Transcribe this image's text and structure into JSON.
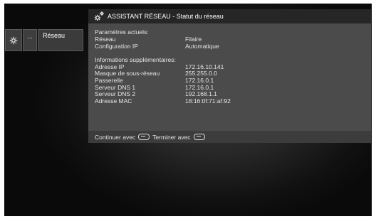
{
  "nav": {
    "settings_icon": "gear-icon",
    "more_label": "...",
    "network_label": "Réseau"
  },
  "dialog": {
    "icon": "gears-icon",
    "title": "ASSISTANT RÉSEAU - Statut du réseau",
    "current_params": {
      "title": "Paramètres actuels:",
      "rows": [
        {
          "label": "Réseau",
          "value": "Filaire"
        },
        {
          "label": "Configuration IP",
          "value": "Automatique"
        }
      ]
    },
    "extra_info": {
      "title": "Informations supplémentaires:",
      "rows": [
        {
          "label": "Adresse IP",
          "value": "172.16.10.141"
        },
        {
          "label": "Masque de sous-réseau",
          "value": "255.255.0.0"
        },
        {
          "label": "Passerelle",
          "value": "172.16.0.1"
        },
        {
          "label": "Serveur DNS 1",
          "value": "172.16.0.1"
        },
        {
          "label": "Serveur DNS 2",
          "value": "192.168.1.1"
        },
        {
          "label": "Adresse MAC",
          "value": "18:16:0f:71:af:92"
        }
      ]
    },
    "footer": {
      "continue_label": "Continuer avec",
      "continue_icon": "remote-ok-button-icon",
      "finish_label": "Terminer avec",
      "finish_icon": "remote-back-button-icon"
    }
  }
}
